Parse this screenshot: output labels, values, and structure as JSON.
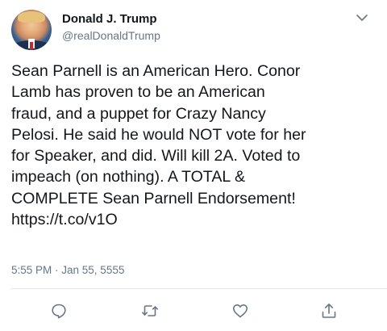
{
  "user": {
    "name": "Donald J. Trump",
    "handle": "@realDonaldTrump",
    "avatar_icon": "profile-photo"
  },
  "tweet": {
    "lines": [
      "Sean Parnell is an American Hero. Conor",
      "Lamb has proven to be an American",
      "fraud, and a puppet for Crazy Nancy",
      "Pelosi. He said he would NOT vote for her",
      "for Speaker, and did. Will kill 2A. Voted to",
      "impeach (on nothing). A TOTAL &",
      "COMPLETE Sean Parnell Endorsement!",
      "https://t.co/v1O"
    ],
    "timestamp": "5:55 PM · Jan 55, 5555"
  },
  "actions": {
    "reply_icon": "reply-icon",
    "retweet_icon": "retweet-icon",
    "like_icon": "heart-icon",
    "share_icon": "share-icon"
  },
  "colors": {
    "text": "#14171a",
    "secondary": "#657786",
    "icon": "#657786",
    "divider": "#e1e8ed"
  }
}
